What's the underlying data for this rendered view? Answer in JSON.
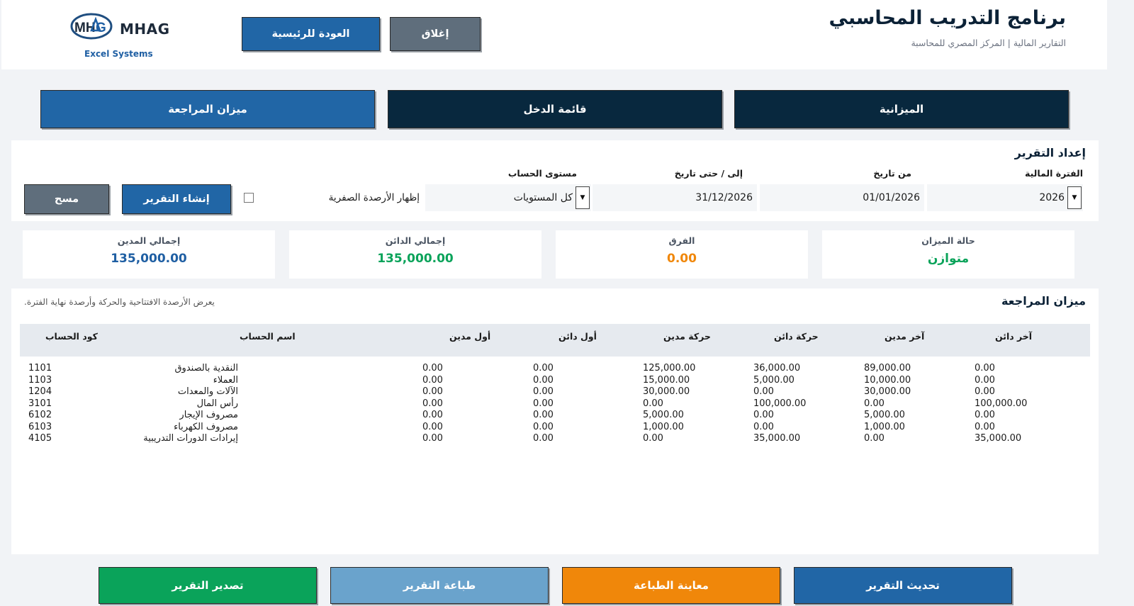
{
  "header": {
    "title": "برنامج التدريب المحاسبي",
    "subtitle": "التقارير المالية | المركز المصري للمحاسبة",
    "close_label": "إغلاق",
    "home_label": "العودة للرئيسية",
    "logo_text": "MHAG",
    "logo_sub": "Excel Systems"
  },
  "tabs": [
    {
      "label": "الميزانية"
    },
    {
      "label": "قائمة الدخل"
    },
    {
      "label": "ميزان المراجعة"
    }
  ],
  "setup": {
    "title": "إعداد التقرير",
    "period_label": "الفترة المالية",
    "period_value": "2026",
    "from_label": "من تاريخ",
    "from_value": "01/01/2026",
    "to_label": "إلى / حتى تاريخ",
    "to_value": "31/12/2026",
    "level_label": "مستوى الحساب",
    "level_value": "كل المستويات",
    "zero_label": "إظهار الأرصدة الصفرية",
    "zero_checked": false,
    "generate_label": "إنشاء التقرير",
    "clear_label": "مسح"
  },
  "summary": {
    "status_label": "حالة الميزان",
    "status_value": "متوازن",
    "diff_label": "الفرق",
    "diff_value": "0.00",
    "credit_label": "إجمالي الدائن",
    "credit_value": "135,000.00",
    "debit_label": "إجمالي المدين",
    "debit_value": "135,000.00"
  },
  "table": {
    "title": "ميزان المراجعة",
    "note": "يعرض الأرصدة الافتتاحية والحركة وأرصدة نهاية الفترة.",
    "headers": {
      "code": "كود الحساب",
      "name": "اسم الحساب",
      "open_debit": "أول مدين",
      "open_credit": "أول دائن",
      "move_debit": "حركة مدين",
      "move_credit": "حركة دائن",
      "end_debit": "آخر مدين",
      "end_credit": "آخر دائن"
    },
    "rows": [
      {
        "code": "1101",
        "name": "النقدية بالصندوق",
        "open_debit": "0.00",
        "open_credit": "0.00",
        "move_debit": "125,000.00",
        "move_credit": "36,000.00",
        "end_debit": "89,000.00",
        "end_credit": "0.00"
      },
      {
        "code": "1103",
        "name": "العملاء",
        "open_debit": "0.00",
        "open_credit": "0.00",
        "move_debit": "15,000.00",
        "move_credit": "5,000.00",
        "end_debit": "10,000.00",
        "end_credit": "0.00"
      },
      {
        "code": "1204",
        "name": "الآلات والمعدات",
        "open_debit": "0.00",
        "open_credit": "0.00",
        "move_debit": "30,000.00",
        "move_credit": "0.00",
        "end_debit": "30,000.00",
        "end_credit": "0.00"
      },
      {
        "code": "3101",
        "name": "رأس المال",
        "open_debit": "0.00",
        "open_credit": "0.00",
        "move_debit": "0.00",
        "move_credit": "100,000.00",
        "end_debit": "0.00",
        "end_credit": "100,000.00"
      },
      {
        "code": "6102",
        "name": "مصروف الإيجار",
        "open_debit": "0.00",
        "open_credit": "0.00",
        "move_debit": "5,000.00",
        "move_credit": "0.00",
        "end_debit": "5,000.00",
        "end_credit": "0.00"
      },
      {
        "code": "6103",
        "name": "مصروف الكهرباء",
        "open_debit": "0.00",
        "open_credit": "0.00",
        "move_debit": "1,000.00",
        "move_credit": "0.00",
        "end_debit": "1,000.00",
        "end_credit": "0.00"
      },
      {
        "code": "4105",
        "name": "إيرادات الدورات التدريبية",
        "open_debit": "0.00",
        "open_credit": "0.00",
        "move_debit": "0.00",
        "move_credit": "35,000.00",
        "end_debit": "0.00",
        "end_credit": "35,000.00"
      }
    ]
  },
  "footer": {
    "refresh_label": "تحديث التقرير",
    "preview_label": "معاينة الطباعة",
    "print_label": "طباعة التقرير",
    "export_label": "تصدير التقرير"
  },
  "colors": {
    "primary": "#2166a6",
    "dark": "#08283e",
    "gray": "#5f6e7c",
    "green": "#0aa35a",
    "orange": "#f0870a",
    "light_blue": "#6aa3cc"
  }
}
